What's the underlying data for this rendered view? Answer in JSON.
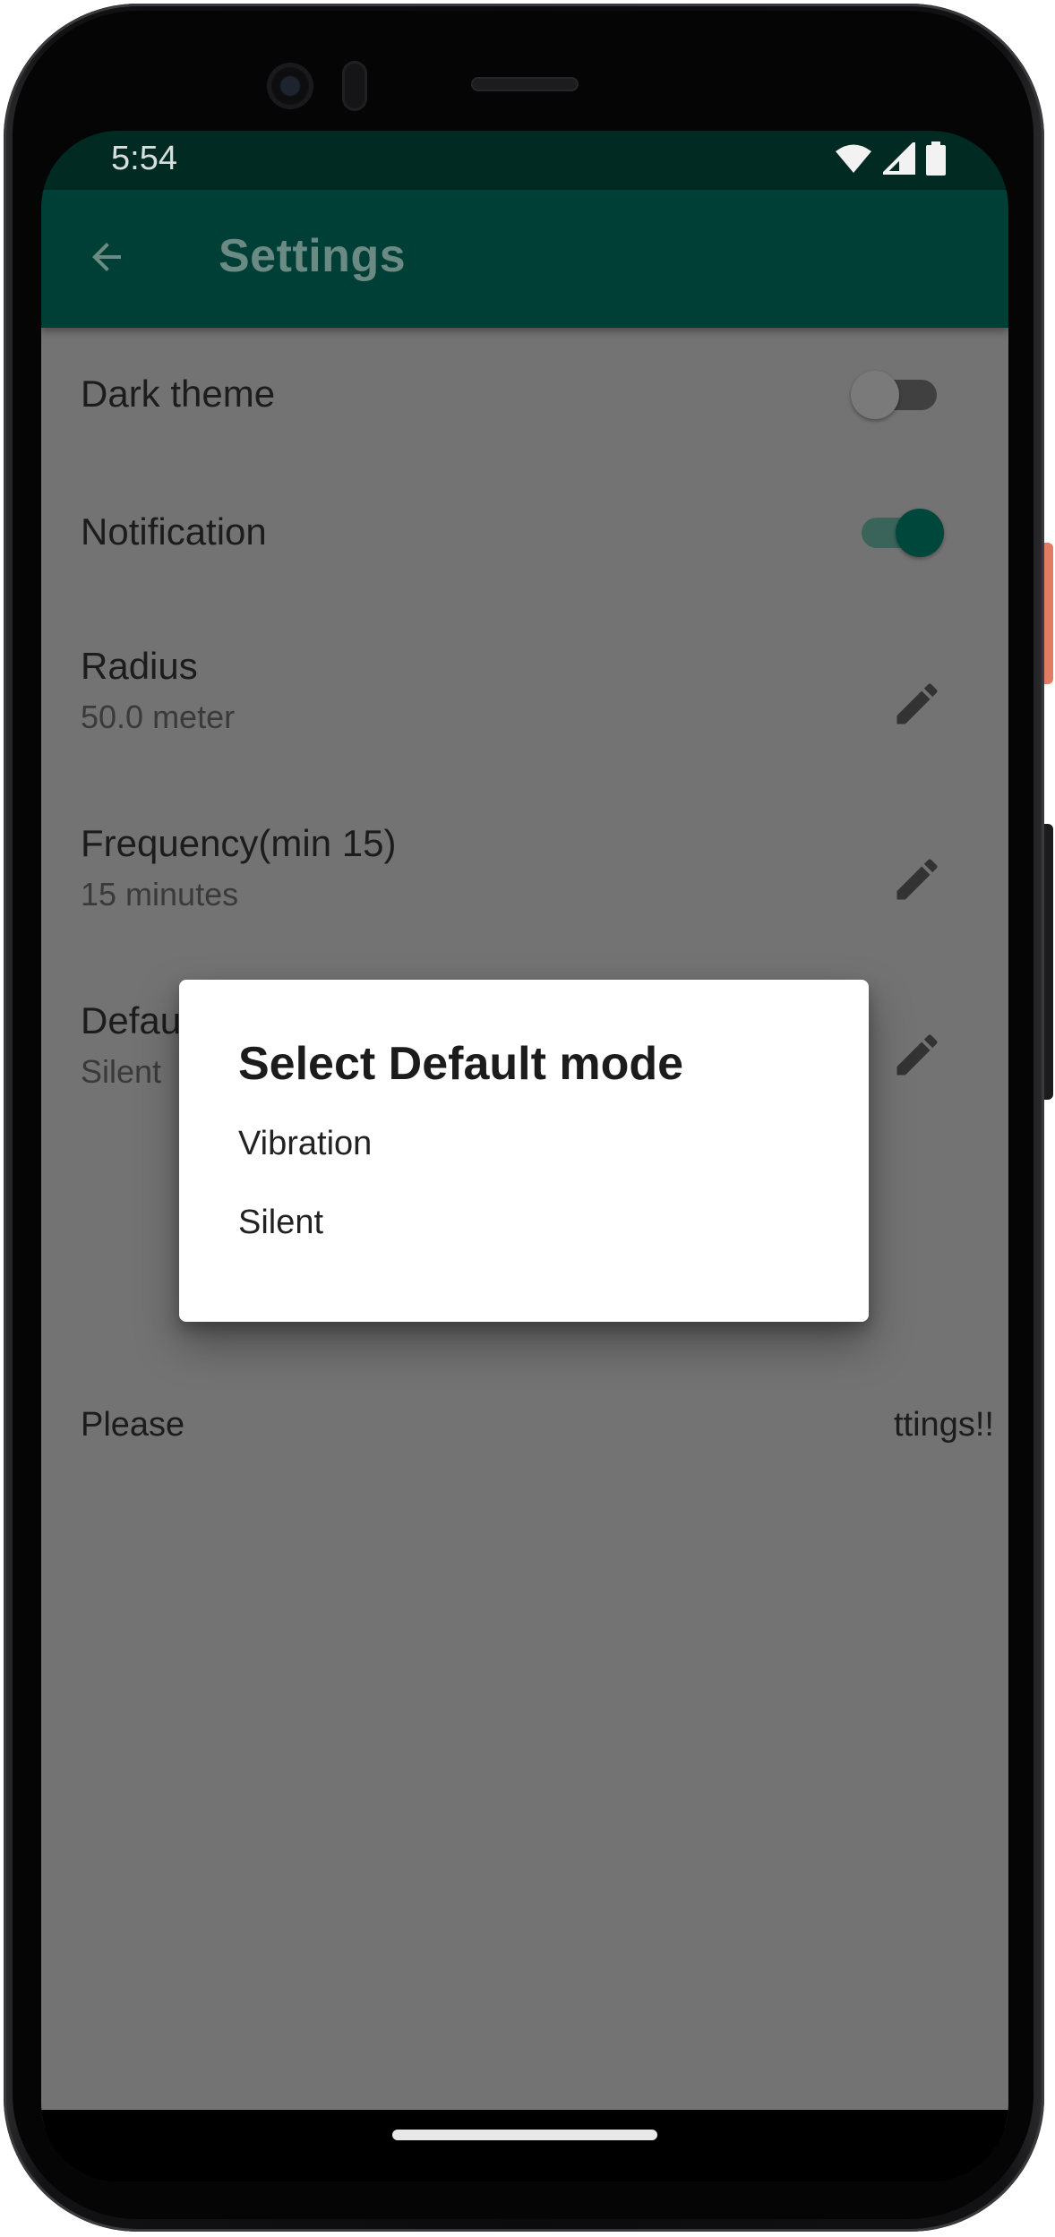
{
  "status_bar": {
    "time": "5:54",
    "icons": [
      "wifi-icon",
      "signal-icon",
      "battery-icon"
    ]
  },
  "app_bar": {
    "back_icon": "arrow-back-icon",
    "title": "Settings"
  },
  "settings": {
    "dark_theme": {
      "label": "Dark theme",
      "enabled": false
    },
    "notification": {
      "label": "Notification",
      "enabled": true
    },
    "radius": {
      "label": "Radius",
      "value": "50.0 meter"
    },
    "frequency": {
      "label": "Frequency(min 15)",
      "value": "15 minutes"
    },
    "default_mode": {
      "label": "Defau",
      "value": "Silent"
    },
    "edit_icon": "pencil-icon"
  },
  "info_text": {
    "left": "Please",
    "right": "ttings!!"
  },
  "dialog": {
    "title": "Select Default mode",
    "options": [
      "Vibration",
      "Silent"
    ]
  },
  "colors": {
    "status_bar": "#002a22",
    "app_bar": "#003f35",
    "scrim_background": "#737373",
    "accent": "#00473b"
  }
}
